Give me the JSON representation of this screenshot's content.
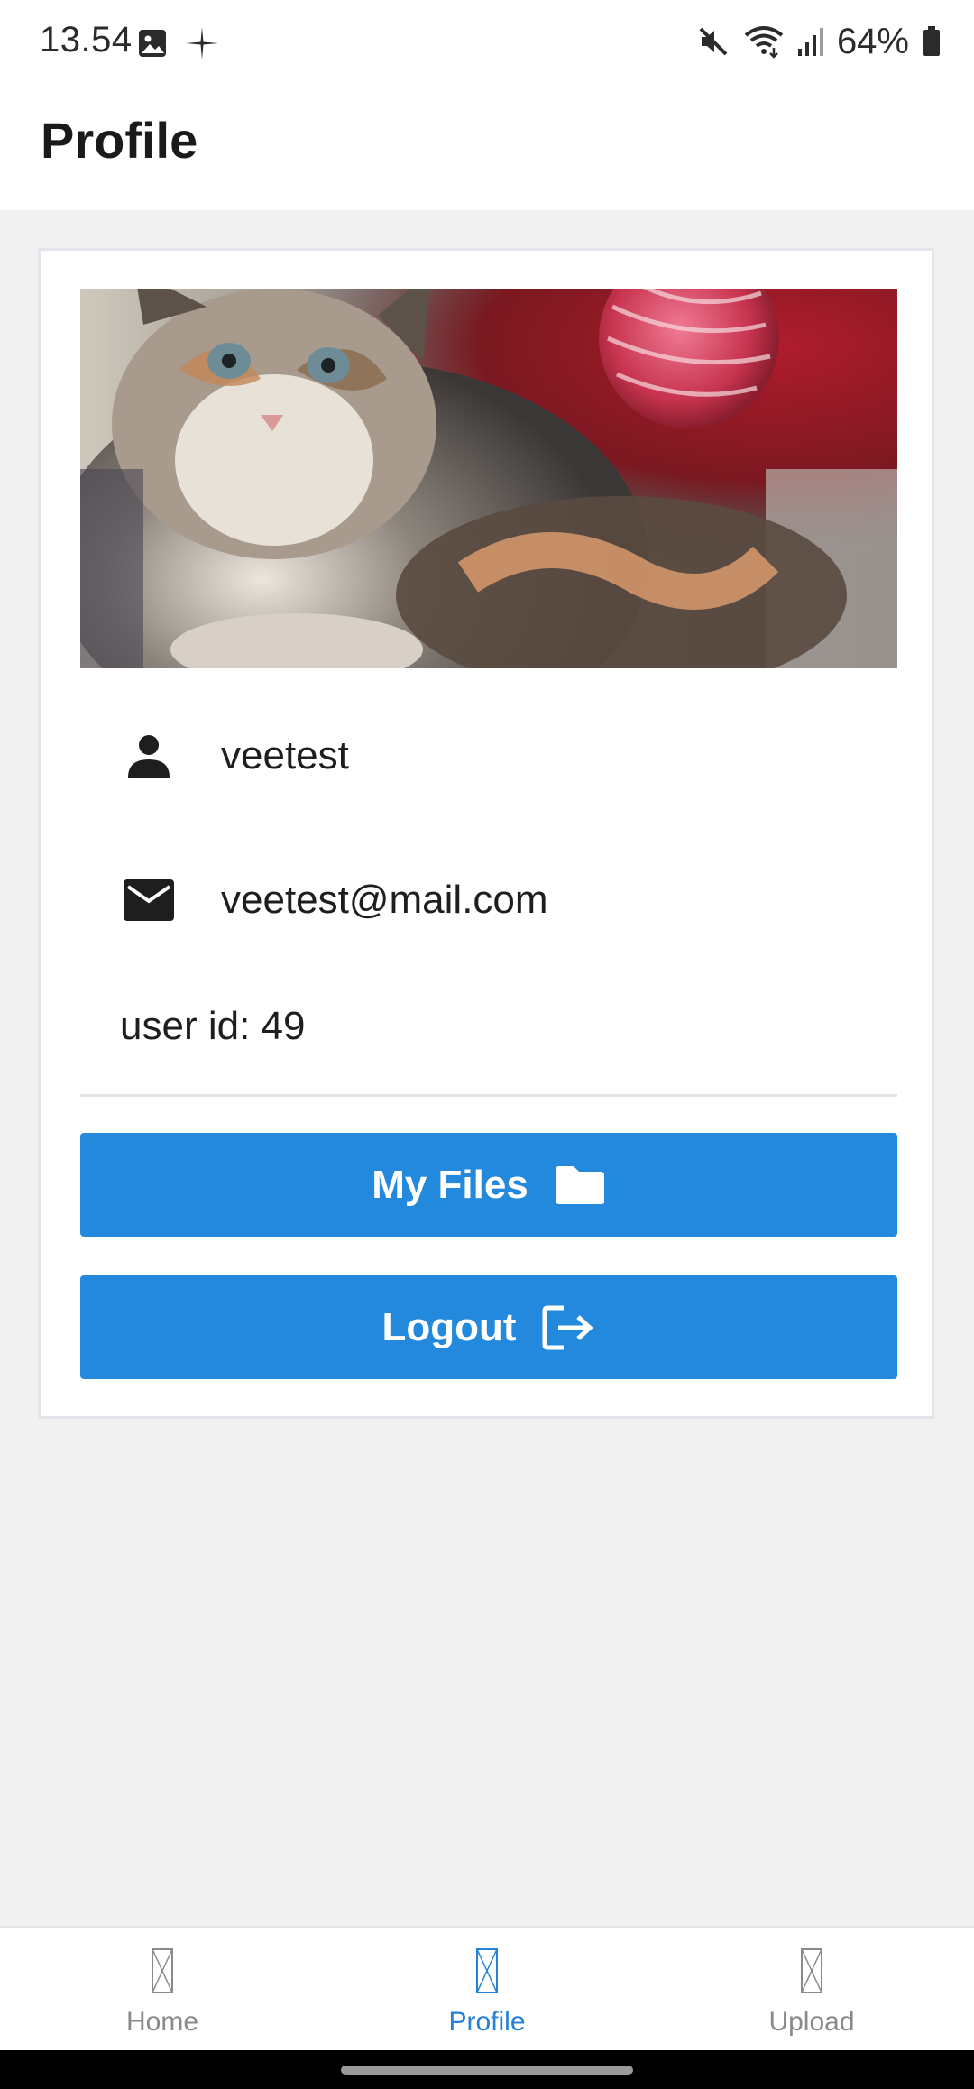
{
  "status_bar": {
    "time": "13.54",
    "battery": "64%",
    "icons": [
      "gallery-icon",
      "sparkle-icon",
      "mute-icon",
      "wifi-icon",
      "signal-icon",
      "battery-icon"
    ]
  },
  "app_bar": {
    "title": "Profile"
  },
  "profile": {
    "image_alt": "kitten profile picture",
    "username": "veetest",
    "email": "veetest@mail.com",
    "user_id_label": "user id: 49"
  },
  "buttons": {
    "my_files": "My Files",
    "logout": "Logout"
  },
  "bottom_nav": {
    "items": [
      {
        "label": "Home",
        "active": false
      },
      {
        "label": "Profile",
        "active": true
      },
      {
        "label": "Upload",
        "active": false
      }
    ]
  },
  "colors": {
    "primary": "#2389dc",
    "active_nav": "#2581d6",
    "inactive_nav": "#8a8a8a",
    "background": "#f1f1f1"
  }
}
